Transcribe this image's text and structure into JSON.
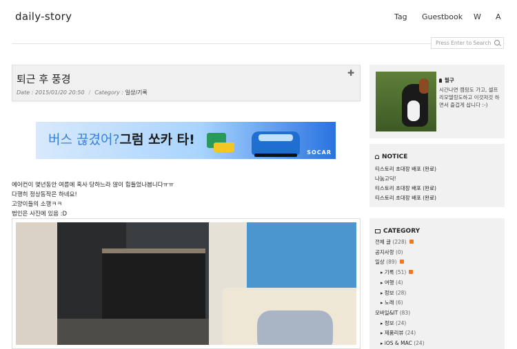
{
  "header": {
    "site_title": "daily-story",
    "nav": [
      "Tag",
      "Guestbook",
      "W",
      "A"
    ],
    "search_placeholder": "Press Enter to Search"
  },
  "post": {
    "title": "퇴근 후 풍경",
    "date_label": "Date : 2015/01/20 20:50",
    "category_label": "Category :",
    "category_value": "일상/기록",
    "body_lines": [
      "에어컨이 몇년동안 여름에 혹사 당하느라 많이 힘들었나봅니다ㅠㅠ",
      "다행히 정상동작은 하네요!",
      "고양이들의 소행ㅋㅋ",
      "범인은 사진에 있음 :D"
    ]
  },
  "ad": {
    "text_light": "버스 끊겼어?",
    "text_bold": "그럼 쏘카 타!",
    "brand": "SOCAR",
    "close": "ⓧ"
  },
  "sidebar": {
    "profile_name": "필구",
    "profile_desc": "시간나면 캠핑도 가고, 셀프 리모델링도하고 이것저것 하면서 즐겁게 삽니다 :-)",
    "notice_title": "NOTICE",
    "notice_items": [
      "티스토리 초대장 배포 (완료)",
      "나눔고딕!",
      "티스토리 초대장 배포 (완료)",
      "티스토리 초대장 배포 (완료)"
    ],
    "category_title": "CATEGORY",
    "categories": [
      {
        "label": "전체 글",
        "count": "(228)",
        "rss": true,
        "sub": false
      },
      {
        "label": "공지사항",
        "count": "(0)",
        "rss": false,
        "sub": false
      },
      {
        "label": "일상",
        "count": "(89)",
        "rss": true,
        "sub": false
      },
      {
        "label": "기록",
        "count": "(51)",
        "rss": true,
        "sub": true
      },
      {
        "label": "여행",
        "count": "(4)",
        "rss": false,
        "sub": true
      },
      {
        "label": "정보",
        "count": "(28)",
        "rss": false,
        "sub": true
      },
      {
        "label": "노래",
        "count": "(6)",
        "rss": false,
        "sub": true
      },
      {
        "label": "모바일&IT",
        "count": "(83)",
        "rss": false,
        "sub": false
      },
      {
        "label": "정보",
        "count": "(24)",
        "rss": false,
        "sub": true
      },
      {
        "label": "제품리뷰",
        "count": "(24)",
        "rss": false,
        "sub": true
      },
      {
        "label": "iOS & MAC",
        "count": "(24)",
        "rss": false,
        "sub": true
      }
    ]
  }
}
